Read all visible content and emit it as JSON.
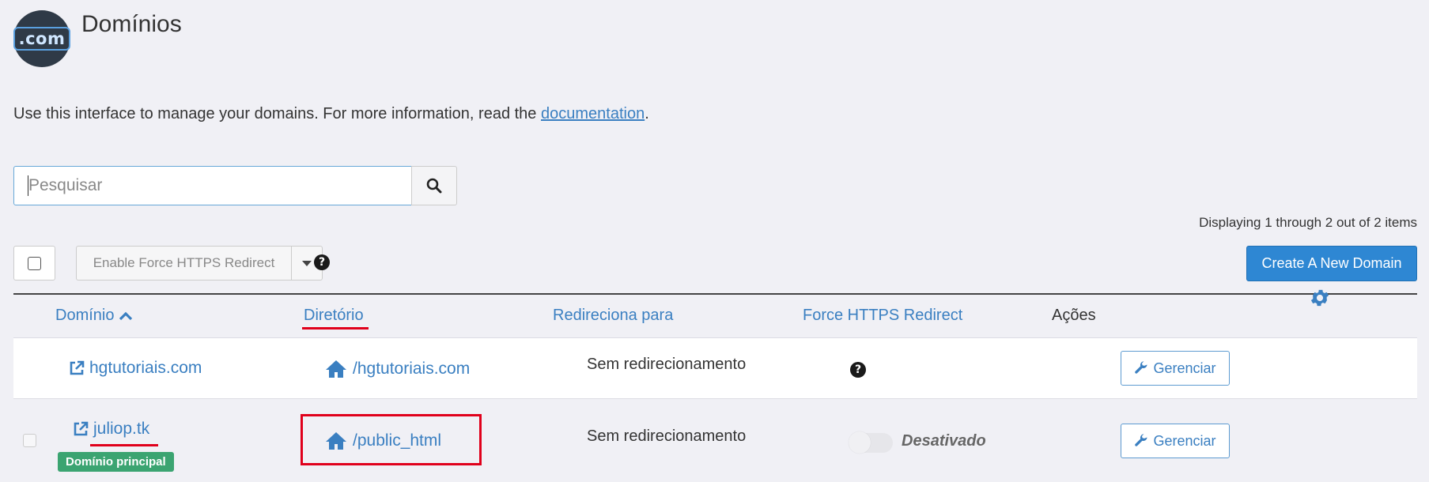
{
  "header": {
    "logo_text": ".com",
    "title": "Domínios"
  },
  "intro": {
    "text": "Use this interface to manage your domains. For more information, read the ",
    "link_label": "documentation",
    "suffix": "."
  },
  "search": {
    "placeholder": "Pesquisar"
  },
  "pagination": {
    "summary": "Displaying 1 through 2 out of 2 items"
  },
  "toolbar": {
    "bulk_action_label": "Enable Force HTTPS Redirect",
    "help_symbol": "?",
    "create_label": "Create A New Domain"
  },
  "table": {
    "columns": {
      "domain": "Domínio",
      "directory": "Diretório",
      "redirect": "Redireciona para",
      "force_https": "Force HTTPS Redirect",
      "actions": "Ações"
    },
    "sort": {
      "column": "domain",
      "direction": "ascending"
    },
    "rows": [
      {
        "domain": "hgtutoriais.com",
        "directory": "/hgtutoriais.com",
        "redirect": "Sem redirecionamento",
        "force_https": "?",
        "action": "Gerenciar"
      },
      {
        "domain": "juliop.tk",
        "badge": "Domínio principal",
        "directory": "/public_html",
        "redirect": "Sem redirecionamento",
        "force_https": "Desativado",
        "action": "Gerenciar"
      }
    ]
  },
  "colors": {
    "accent": "#3a7fc1",
    "primary_button": "#2e87d3",
    "badge": "#3ba471",
    "highlight": "#e0001b",
    "background": "#f0f0f5"
  },
  "icons": {
    "search": "search-icon",
    "external_link": "external-link-icon",
    "home": "home-icon",
    "wrench": "wrench-icon",
    "gear": "gear-icon",
    "chevron_up": "chevron-up-icon",
    "caret_down": "caret-down-icon",
    "question": "question-circle-icon"
  }
}
